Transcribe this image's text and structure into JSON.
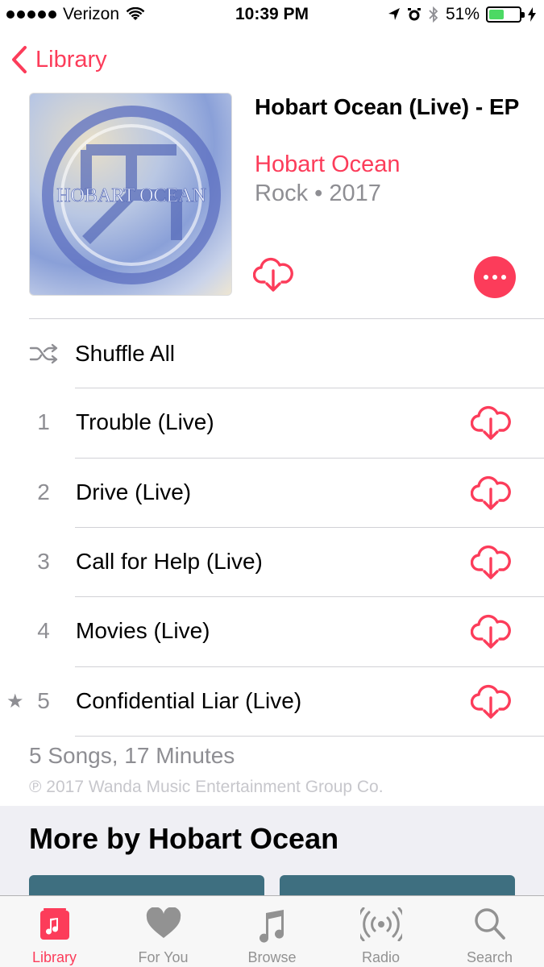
{
  "status_bar": {
    "carrier": "Verizon",
    "time": "10:39 PM",
    "battery": "51%",
    "battery_level": 0.51
  },
  "nav": {
    "back_label": "Library"
  },
  "album": {
    "art_text": "HOBART OCEAN",
    "title": "Hobart Ocean (Live) - EP",
    "artist": "Hobart Ocean",
    "meta": "Rock • 2017"
  },
  "shuffle_label": "Shuffle All",
  "tracks": [
    {
      "number": "1",
      "title": "Trouble (Live)",
      "starred": false
    },
    {
      "number": "2",
      "title": "Drive (Live)",
      "starred": false
    },
    {
      "number": "3",
      "title": "Call for Help (Live)",
      "starred": false
    },
    {
      "number": "4",
      "title": "Movies (Live)",
      "starred": false
    },
    {
      "number": "5",
      "title": "Confidential Liar (Live)",
      "starred": true,
      "star": "★"
    }
  ],
  "summary": "5 Songs, 17 Minutes",
  "copyright": "℗ 2017 Wanda Music Entertainment Group Co.",
  "more_by": {
    "title": "More by Hobart Ocean"
  },
  "tab_bar": {
    "tabs": [
      {
        "label": "Library",
        "icon": "library-icon",
        "active": true
      },
      {
        "label": "For You",
        "icon": "heart-icon",
        "active": false
      },
      {
        "label": "Browse",
        "icon": "music-note-icon",
        "active": false
      },
      {
        "label": "Radio",
        "icon": "radio-icon",
        "active": false
      },
      {
        "label": "Search",
        "icon": "search-icon",
        "active": false
      }
    ]
  },
  "colors": {
    "accent": "#fc3c5a",
    "battery": "#4cd964",
    "secondary_text": "#8e8e93"
  }
}
